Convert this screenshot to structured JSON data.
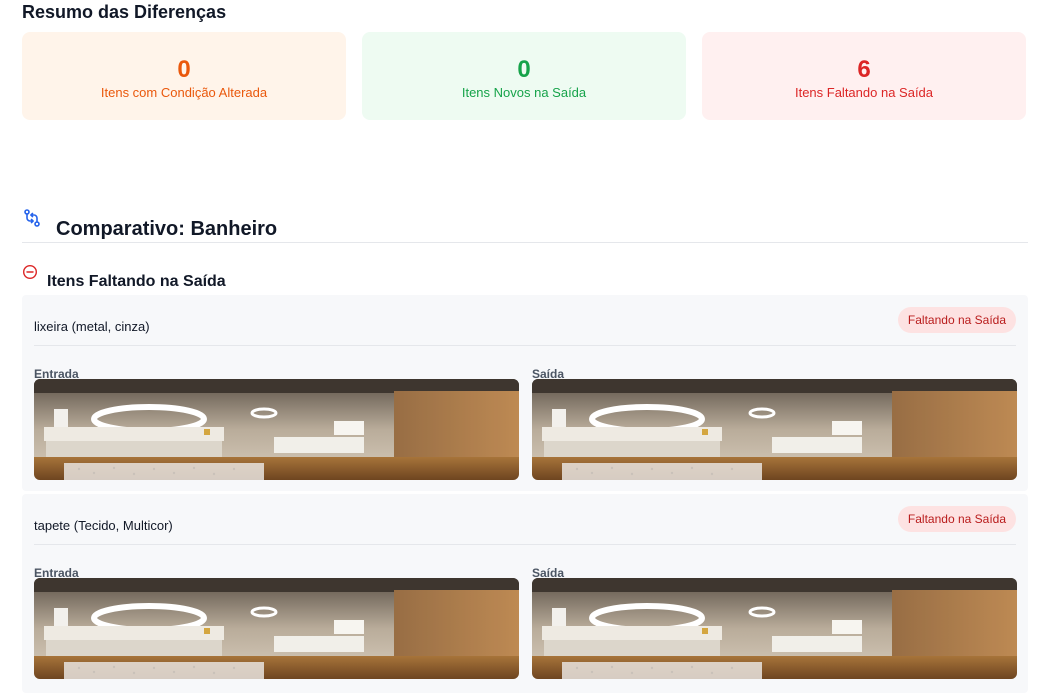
{
  "summary": {
    "title": "Resumo das Diferenças",
    "cards": [
      {
        "value": "0",
        "label": "Itens com Condição Alterada",
        "color": "#ea580c"
      },
      {
        "value": "0",
        "label": "Itens Novos na Saída",
        "color": "#16a34a"
      },
      {
        "value": "6",
        "label": "Itens Faltando na Saída",
        "color": "#dc2626"
      }
    ]
  },
  "comparison": {
    "icon": "compare-arrows-icon",
    "title": "Comparativo: Banheiro",
    "missing_section": {
      "icon": "minus-circle-icon",
      "title": "Itens Faltando na Saída",
      "items": [
        {
          "name": "lixeira (metal, cinza)",
          "status": "Faltando na Saída",
          "entry_label": "Entrada",
          "exit_label": "Saída"
        },
        {
          "name": "tapete (Tecido, Multicor)",
          "status": "Faltando na Saída",
          "entry_label": "Entrada",
          "exit_label": "Saída"
        }
      ]
    }
  }
}
